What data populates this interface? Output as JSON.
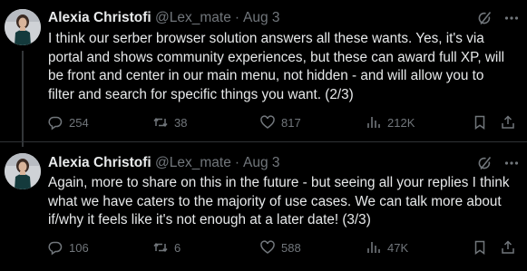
{
  "tweets": [
    {
      "author": "Alexia Christofi",
      "handle": "@Lex_mate",
      "separator": "·",
      "date": "Aug 3",
      "text": "I think our serber browser solution answers all these wants. Yes, it's via\nportal and shows community experiences, but these can award full XP, will\nbe front and center in our main menu, not hidden - and will allow you to\nfilter and search for specific things you want.  (2/3)",
      "stats": {
        "replies": "254",
        "reposts": "38",
        "likes": "817",
        "views": "212K"
      }
    },
    {
      "author": "Alexia Christofi",
      "handle": "@Lex_mate",
      "separator": "·",
      "date": "Aug 3",
      "text": "Again, more to share on this in the future - but seeing all your replies I think\nwhat we have caters to the majority of use cases. We can talk more about\nif/why it feels like it's not enough at a later date! (3/3)",
      "stats": {
        "replies": "106",
        "reposts": "6",
        "likes": "588",
        "views": "47K"
      }
    }
  ],
  "colors": {
    "background": "#000000",
    "text_primary": "#e7e9ea",
    "text_secondary": "#71767b",
    "divider": "#2f3336",
    "thread_line": "#333639"
  },
  "icons": [
    "avatar",
    "grok-icon",
    "more-icon",
    "reply-icon",
    "repost-icon",
    "like-icon",
    "views-icon",
    "bookmark-icon",
    "share-icon"
  ]
}
